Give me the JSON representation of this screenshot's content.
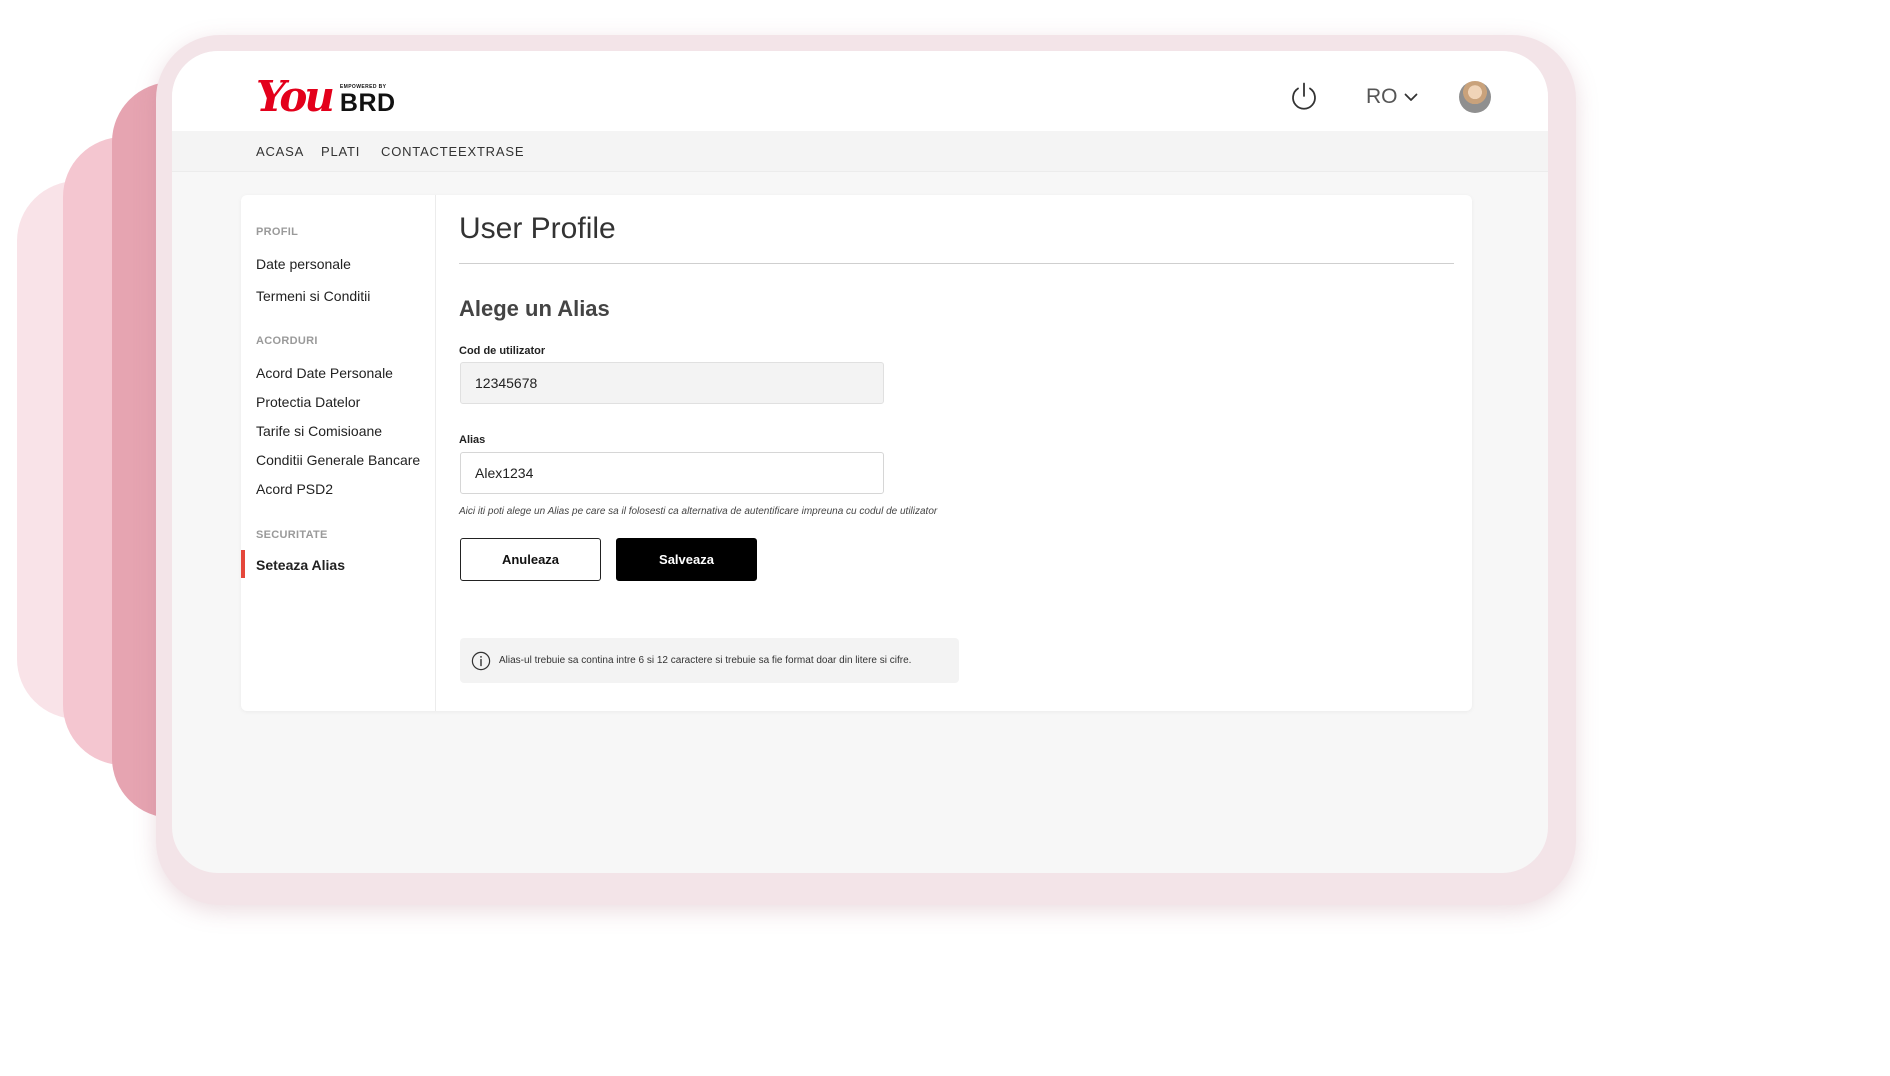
{
  "brand": {
    "logo_text": "You",
    "logo_tagline": "EMPOWERED BY",
    "logo_bank": "BRD",
    "accent_color": "#e3001b"
  },
  "header": {
    "power_icon": "power-icon",
    "language": "RO",
    "language_icon": "chevron-down-icon",
    "avatar_icon": "avatar"
  },
  "nav": {
    "items": [
      {
        "label": "ACASA"
      },
      {
        "label": "PLATI"
      },
      {
        "label": "CONTACTE"
      },
      {
        "label": "EXTRASE"
      }
    ]
  },
  "sidebar": {
    "sections": [
      {
        "heading": "PROFIL",
        "items": [
          "Date personale",
          "Termeni si Conditii"
        ]
      },
      {
        "heading": "ACORDURI",
        "items": [
          "Acord Date Personale",
          "Protectia Datelor",
          "Tarife si Comisioane",
          "Conditii Generale Bancare",
          "Acord PSD2"
        ]
      },
      {
        "heading": "SECURITATE",
        "items": [
          "Seteaza Alias"
        ]
      }
    ],
    "active_item": "Seteaza Alias",
    "active_color": "#e5473b"
  },
  "main": {
    "title": "User Profile",
    "subtitle": "Alege un Alias",
    "user_code": {
      "label": "Cod de utilizator",
      "value": "12345678"
    },
    "alias": {
      "label": "Alias",
      "value": "Alex1234"
    },
    "hint": "Aici iti poti alege un Alias pe care sa il folosesti ca alternativa de autentificare impreuna cu codul de utilizator",
    "cancel_label": "Anuleaza",
    "save_label": "Salveaza",
    "info_icon": "info-icon",
    "info_text": "Alias-ul trebuie sa contina intre 6 si 12 caractere si trebuie sa fie format doar din litere si cifre."
  }
}
